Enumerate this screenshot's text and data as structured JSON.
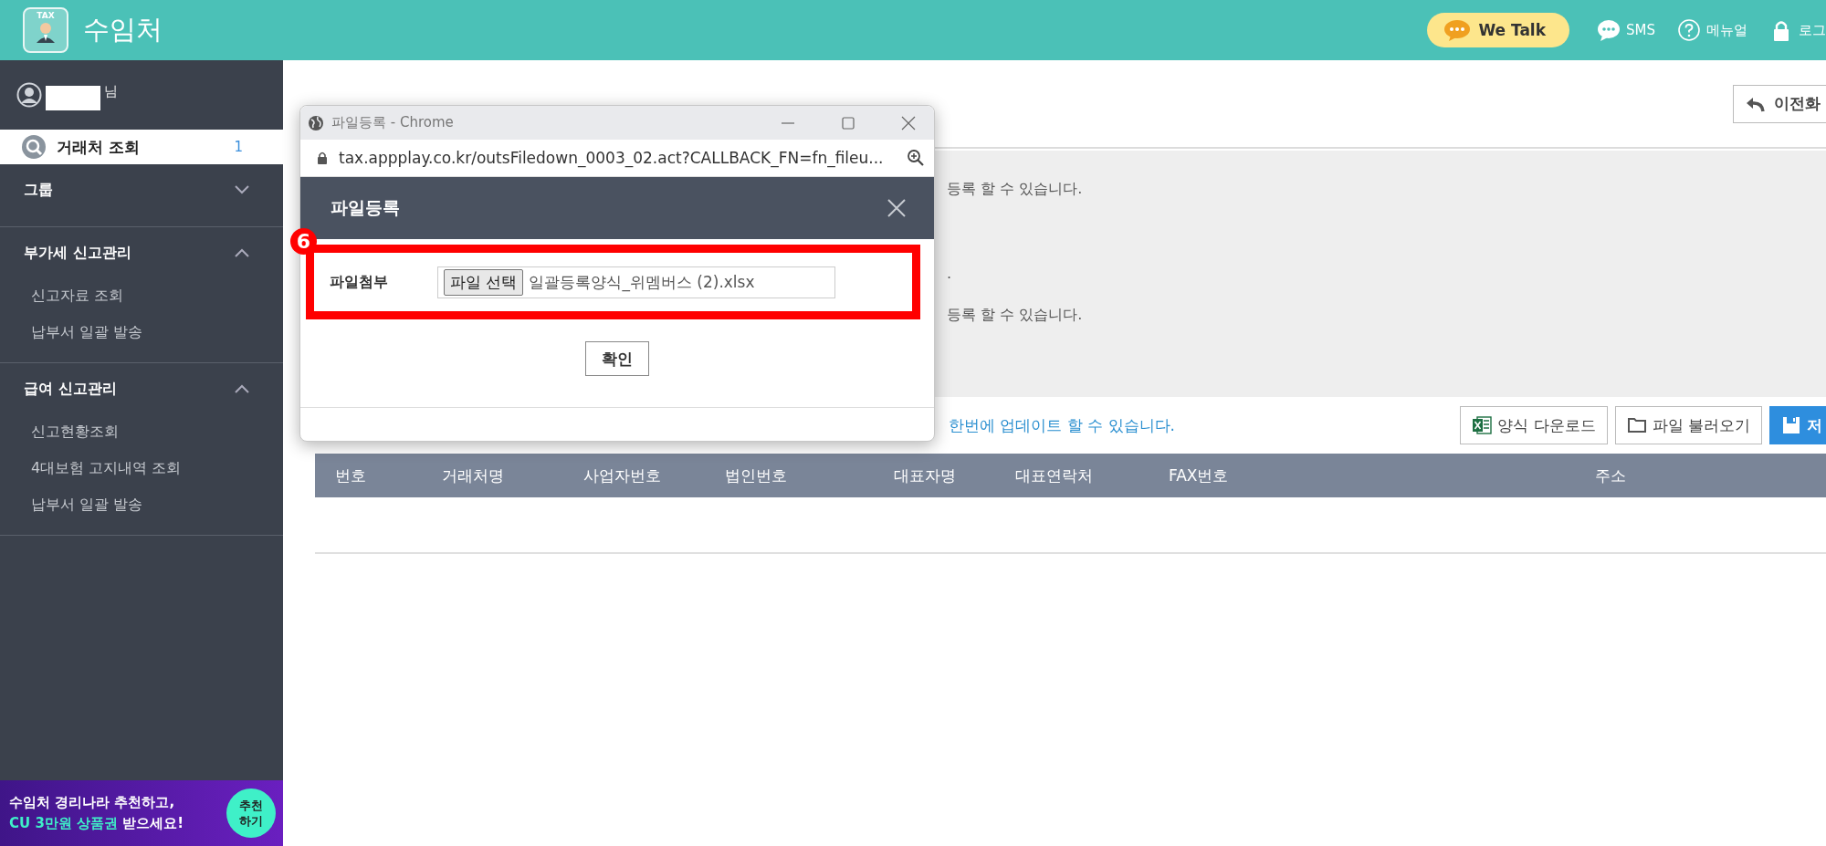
{
  "header": {
    "logo_text": "TAX",
    "title": "수임처",
    "we_talk": "We Talk",
    "links": [
      {
        "kind": "chat",
        "label": "SMS"
      },
      {
        "kind": "help",
        "label": "메뉴얼"
      },
      {
        "kind": "lock",
        "label": "로그"
      }
    ]
  },
  "sidebar": {
    "user_suffix": "님",
    "items": [
      {
        "label": "거래처 조회",
        "count": "1",
        "selected": true
      }
    ],
    "groups": [
      {
        "label": "그룹",
        "expanded": false
      },
      {
        "label": "부가세 신고관리",
        "expanded": true,
        "children": [
          "신고자료 조회",
          "납부서 일괄 발송"
        ]
      },
      {
        "label": "급여 신고관리",
        "expanded": true,
        "children": [
          "신고현황조회",
          "4대보험 고지내역 조회",
          "납부서 일괄 발송"
        ]
      }
    ],
    "promo": {
      "line_1": "수임처 경리나라 추천하고,",
      "highlight": "CU 3만원 상품권",
      "rest": " 받으세요!",
      "button": "추천\n하기"
    }
  },
  "page": {
    "back_button": "이전화",
    "notes": [
      "등록 할 수 있습니다.",
      ".",
      "등록 할 수 있습니다."
    ],
    "link": "한번에 업데이트 할 수 있습니다.",
    "buttons": [
      {
        "kind": "excel",
        "label": "양식 다운로드"
      },
      {
        "kind": "folder",
        "label": "파일 불러오기"
      },
      {
        "kind": "save",
        "label": "저"
      }
    ],
    "table": {
      "columns": [
        "번호",
        "거래처명",
        "사업자번호",
        "법인번호",
        "대표자명",
        "대표연락처",
        "FAX번호",
        "주소"
      ]
    }
  },
  "popup": {
    "window_title": "파일등록 - Chrome",
    "url": "tax.appplay.co.kr/outsFiledown_0003_02.act?CALLBACK_FN=fn_fileu...",
    "dialog_title": "파일등록",
    "step_badge": "6",
    "field_label": "파일첨부",
    "choose_button": "파일 선택",
    "file_name": "일괄등록양식_위멤버스 (2).xlsx",
    "confirm": "확인"
  }
}
